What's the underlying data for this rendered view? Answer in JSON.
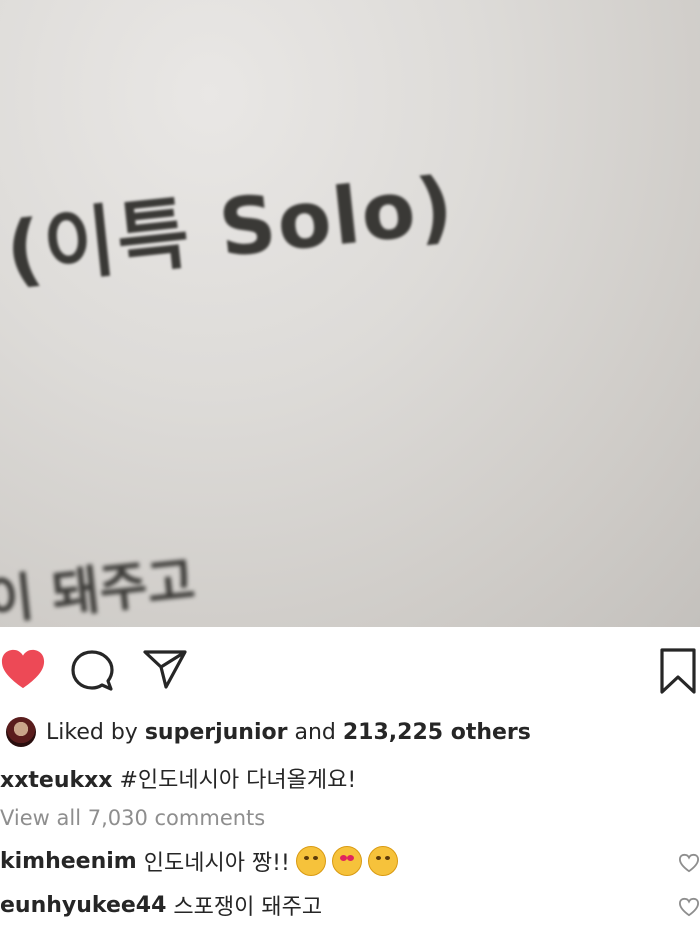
{
  "photo": {
    "main_text": "(이특  Solo)",
    "sub_text": "이 돼주고"
  },
  "post": {
    "liker_username": "superjunior",
    "likes_prefix": "Liked by",
    "likes_connector": "and",
    "likes_count_text": "213,225 others",
    "author": "xxteukxx",
    "caption_text": "#인도네시아 다녀올게요!",
    "view_all_comments": "View all 7,030 comments"
  },
  "comments": [
    {
      "username": "kimheenim",
      "text": "인도네시아 짱!!"
    },
    {
      "username": "eunhyukee44",
      "text": "스포쟁이 돼주고"
    }
  ],
  "colors": {
    "liked_heart": "#ed4956",
    "icon_stroke": "#262626",
    "muted_text": "#8e8e8e"
  },
  "icons": [
    "heart-icon",
    "comment-icon",
    "share-icon",
    "bookmark-icon",
    "small-heart-icon"
  ]
}
